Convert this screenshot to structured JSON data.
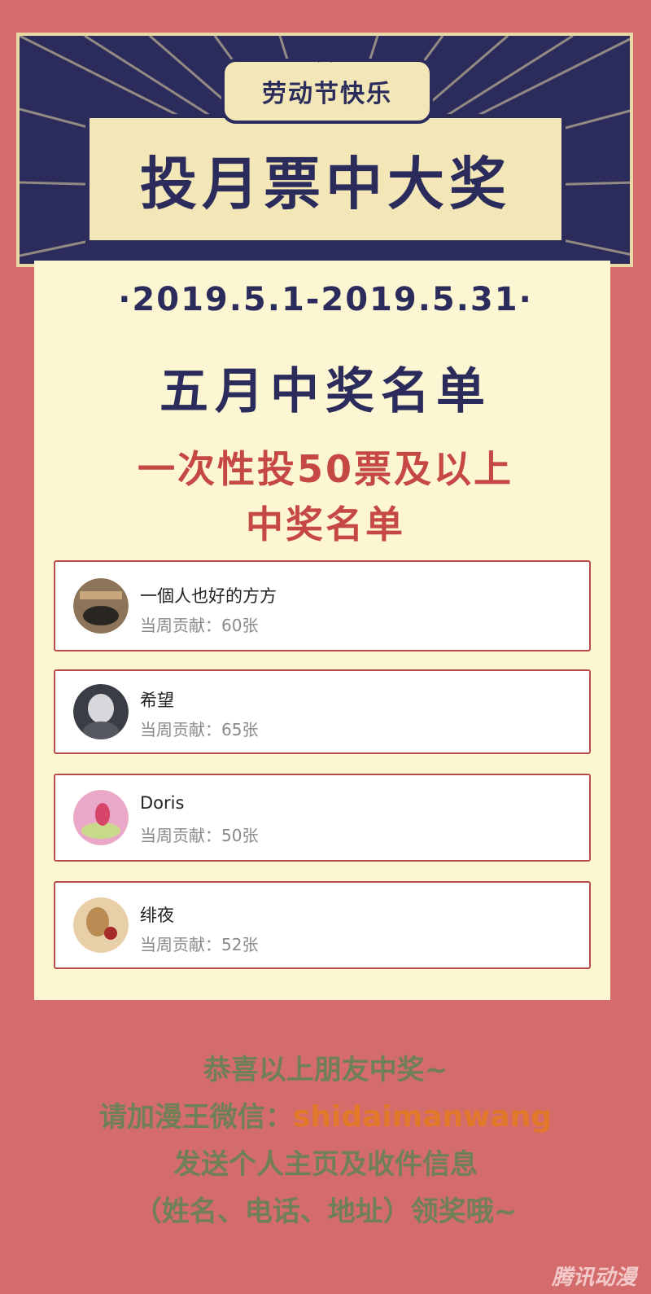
{
  "banner": {
    "top_label": "劳动节快乐",
    "main_label": "投月票中大奖"
  },
  "date_range": "·2019.5.1-2019.5.31·",
  "title": "五月中奖名单",
  "subtitle_line1": "一次性投50票及以上",
  "subtitle_line2": "中奖名单",
  "winners": [
    {
      "name": "一個人也好的方方",
      "contrib_label": "当周贡献：",
      "contrib_value": "60张"
    },
    {
      "name": "希望",
      "contrib_label": "当周贡献：",
      "contrib_value": "65张"
    },
    {
      "name": "Doris",
      "contrib_label": "当周贡献：",
      "contrib_value": "50张"
    },
    {
      "name": "绯夜",
      "contrib_label": "当周贡献：",
      "contrib_value": "52张"
    }
  ],
  "footer": {
    "line1": "恭喜以上朋友中奖~",
    "line2_prefix": "请加漫王微信：",
    "line2_wechat": "shidaimanwang",
    "line3": "发送个人主页及收件信息",
    "line4": "（姓名、电话、地址）领奖哦~"
  },
  "watermark": "腾讯动漫",
  "colors": {
    "background": "#d46c6c",
    "navy": "#2b2c5c",
    "cream": "#fdf6d3",
    "accent_red": "#c64845",
    "footer_green": "#6f8055",
    "wechat_orange": "#e2782a"
  }
}
